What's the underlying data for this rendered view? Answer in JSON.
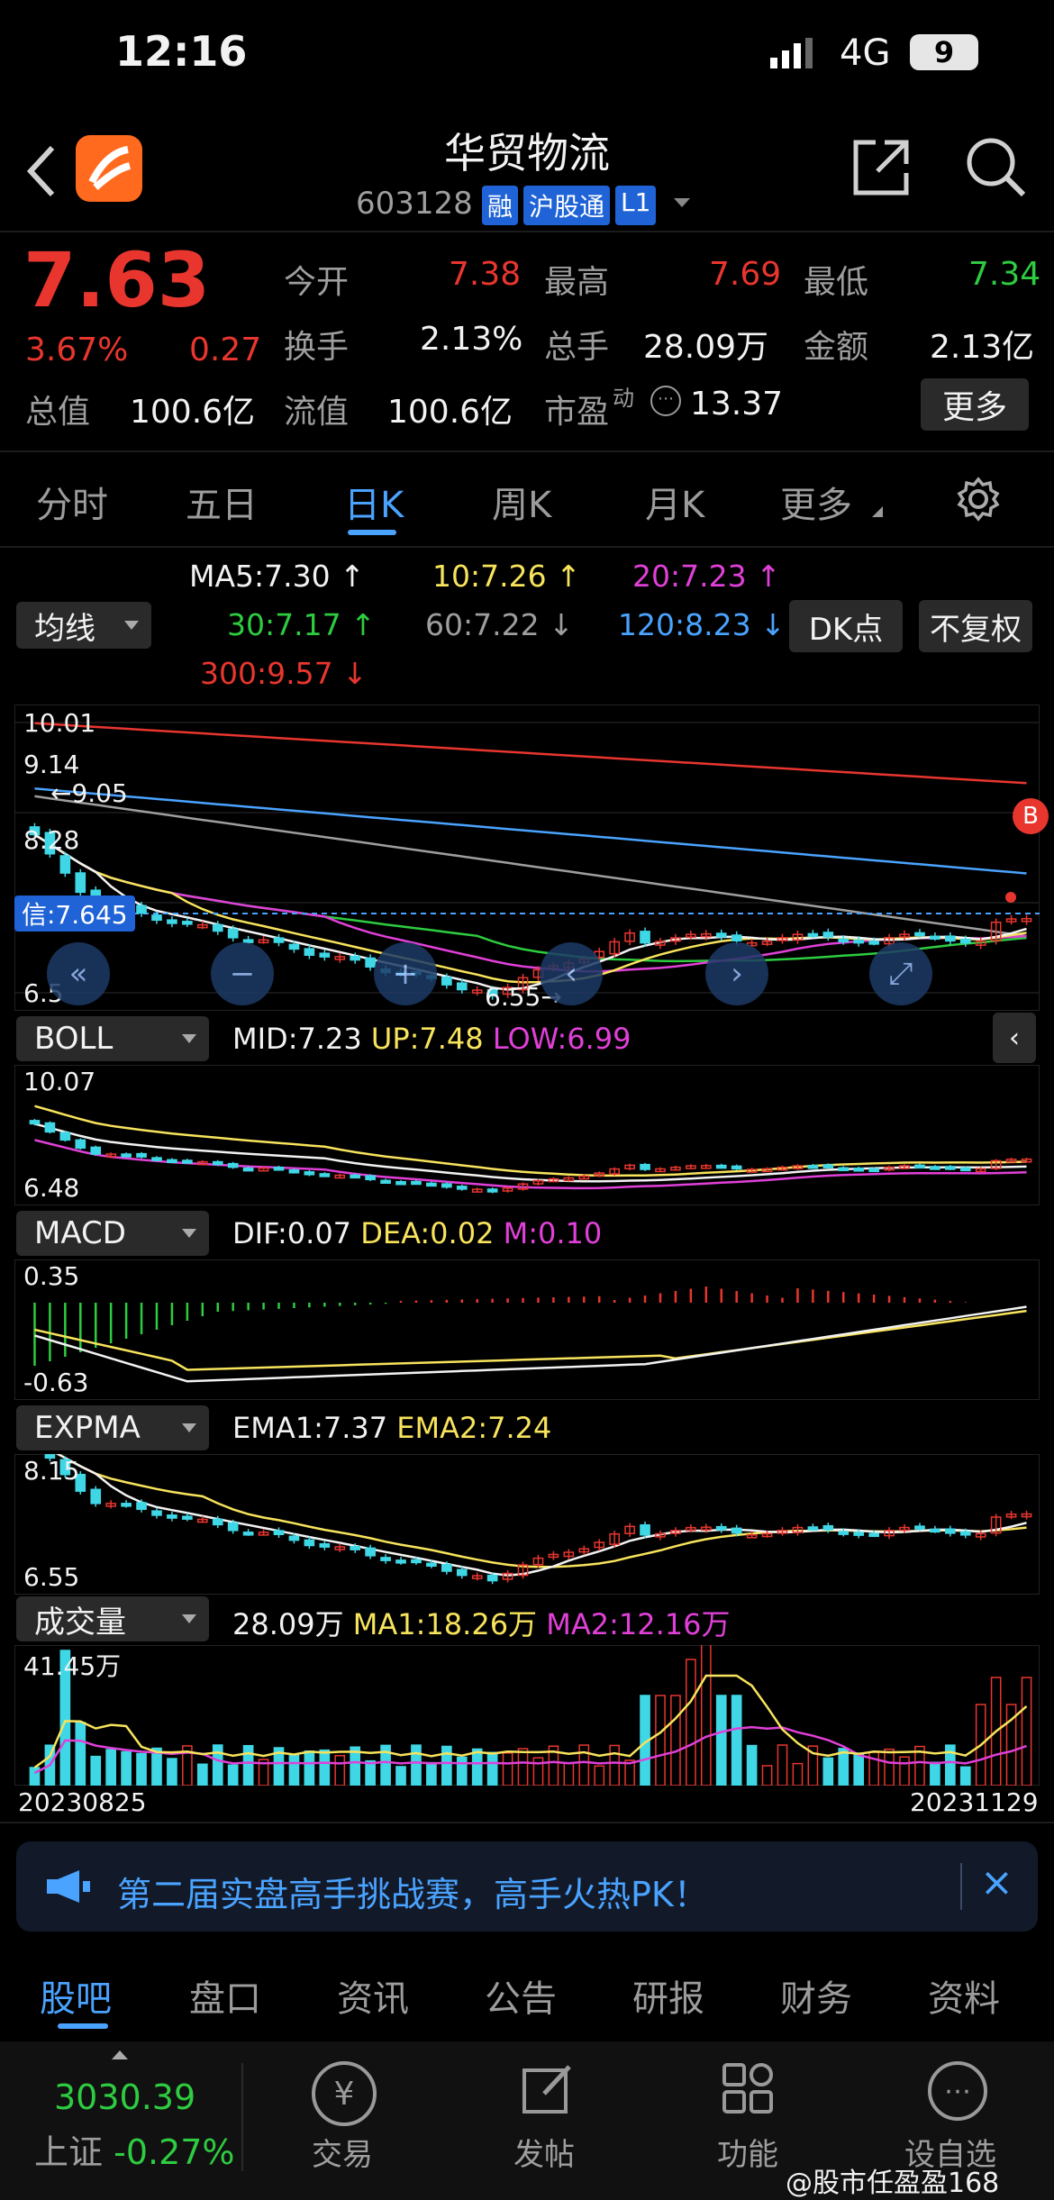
{
  "status_bar": {
    "time": "12:16",
    "network": "4G",
    "battery": "9"
  },
  "header": {
    "title": "华贸物流",
    "code": "603128",
    "tags": [
      "融",
      "沪股通",
      "L1"
    ]
  },
  "quote": {
    "price": "7.63",
    "change_pct": "3.67%",
    "change": "0.27",
    "open_label": "今开",
    "open": "7.38",
    "high_label": "最高",
    "high": "7.69",
    "low_label": "最低",
    "low": "7.34",
    "turnover_label": "换手",
    "turnover": "2.13%",
    "volume_label": "总手",
    "volume": "28.09万",
    "amount_label": "金额",
    "amount": "2.13亿",
    "mcap_label": "总值",
    "mcap": "100.6亿",
    "float_label": "流值",
    "float_cap": "100.6亿",
    "pe_label": "市盈",
    "pe_sup": "动",
    "pe": "13.37",
    "more_label": "更多"
  },
  "period_tabs": [
    "分时",
    "五日",
    "日K",
    "周K",
    "月K",
    "更多"
  ],
  "active_tab": "日K",
  "ma_bar": {
    "selector": "均线",
    "ma5": "MA5:7.30",
    "ma10": "10:7.26",
    "ma20": "20:7.23",
    "ma30": "30:7.17",
    "ma60": "60:7.22",
    "ma120": "120:8.23",
    "ma300": "300:9.57",
    "arrow_up": "↑",
    "arrow_down": "↓",
    "dk_label": "DK点",
    "adjust_label": "不复权"
  },
  "main_chart": {
    "y_labels": [
      "10.01",
      "9.14",
      "8.28"
    ],
    "bottom_label": "6.5",
    "peak_label": "9.05",
    "low_label": "6.55",
    "signal_label": "信:7.645",
    "buy_marker": "B"
  },
  "boll": {
    "selector": "BOLL",
    "mid": "MID:7.23",
    "up": "UP:7.48",
    "low": "LOW:6.99",
    "y_top": "10.07",
    "y_bottom": "6.48"
  },
  "macd": {
    "selector": "MACD",
    "dif": "DIF:0.07",
    "dea": "DEA:0.02",
    "m": "M:0.10",
    "y_top": "0.35",
    "y_bottom": "-0.63"
  },
  "expma": {
    "selector": "EXPMA",
    "ema1": "EMA1:7.37",
    "ema2": "EMA2:7.24",
    "y_top": "8.15",
    "y_bottom": "6.55"
  },
  "volume": {
    "selector": "成交量",
    "value": "28.09万",
    "ma1": "MA1:18.26万",
    "ma2": "MA2:12.16万",
    "y_top": "41.45万",
    "date_start": "20230825",
    "date_end": "20231129"
  },
  "banner": {
    "text": "第二届实盘高手挑战赛，高手火热PK！"
  },
  "bottom_tabs": [
    "股吧",
    "盘口",
    "资讯",
    "公告",
    "研报",
    "财务",
    "资料"
  ],
  "active_bottom_tab": "股吧",
  "footer": {
    "index_value": "3030.39",
    "index_name": "上证",
    "index_change": "-0.27%",
    "items": [
      "交易",
      "发帖",
      "功能",
      "设自选"
    ],
    "watermark": "@股市任盈盈168"
  },
  "colors": {
    "up": "#e8362f",
    "down": "#3fd7e6",
    "accent": "#4aa3ff",
    "background": "#000000"
  }
}
